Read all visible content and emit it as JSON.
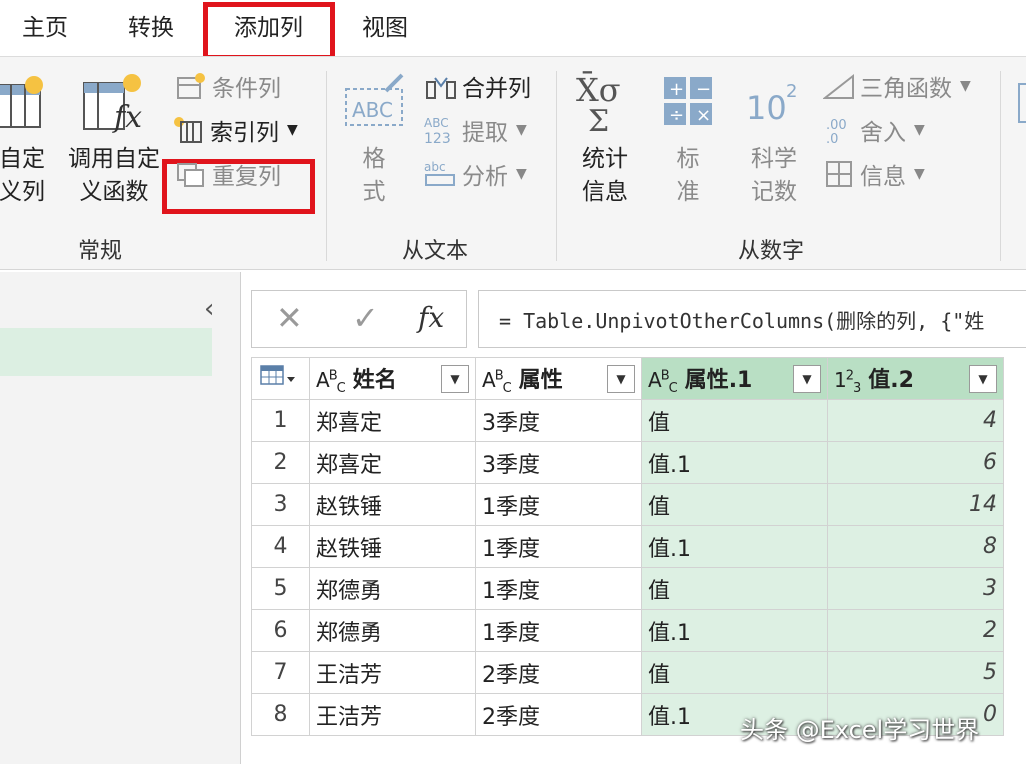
{
  "tabs": [
    {
      "label": "主页"
    },
    {
      "label": "转换"
    },
    {
      "label": "添加列"
    },
    {
      "label": "视图"
    }
  ],
  "ribbon": {
    "general": {
      "custom_column": "自定\n义列",
      "invoke_custom_function": "调用自定\n义函数",
      "conditional_column": "条件列",
      "index_column": "索引列",
      "duplicate_column": "重复列",
      "group_label": "常规"
    },
    "from_text": {
      "format": "格\n式",
      "merge_columns": "合并列",
      "extract": "提取",
      "parse": "分析",
      "group_label": "从文本"
    },
    "from_number": {
      "statistics": "统计\n信息",
      "standard": "标\n准",
      "scientific": "科学\n记数",
      "trigonometry": "三角函数",
      "rounding": "舍入",
      "information": "信息",
      "group_label": "从数字"
    }
  },
  "formula_bar": {
    "text": "= Table.UnpivotOtherColumns(删除的列, {\"姓"
  },
  "table": {
    "columns": [
      {
        "type": "ABC",
        "name": "姓名"
      },
      {
        "type": "ABC",
        "name": "属性"
      },
      {
        "type": "ABC",
        "name": "属性.1"
      },
      {
        "type": "123",
        "name": "值.2"
      }
    ],
    "rows": [
      {
        "n": "1",
        "name": "郑喜定",
        "attr": "3季度",
        "attr1": "值",
        "val": "4"
      },
      {
        "n": "2",
        "name": "郑喜定",
        "attr": "3季度",
        "attr1": "值.1",
        "val": "6"
      },
      {
        "n": "3",
        "name": "赵铁锤",
        "attr": "1季度",
        "attr1": "值",
        "val": "14"
      },
      {
        "n": "4",
        "name": "赵铁锤",
        "attr": "1季度",
        "attr1": "值.1",
        "val": "8"
      },
      {
        "n": "5",
        "name": "郑德勇",
        "attr": "1季度",
        "attr1": "值",
        "val": "3"
      },
      {
        "n": "6",
        "name": "郑德勇",
        "attr": "1季度",
        "attr1": "值.1",
        "val": "2"
      },
      {
        "n": "7",
        "name": "王洁芳",
        "attr": "2季度",
        "attr1": "值",
        "val": "5"
      },
      {
        "n": "8",
        "name": "王洁芳",
        "attr": "2季度",
        "attr1": "值.1",
        "val": "0"
      }
    ]
  },
  "watermark": "头条 @Excel学习世界",
  "colors": {
    "highlight_red": "#e0141c",
    "selected_column_header": "#b9dfc4",
    "selected_column_cells": "#ddf0e3"
  }
}
